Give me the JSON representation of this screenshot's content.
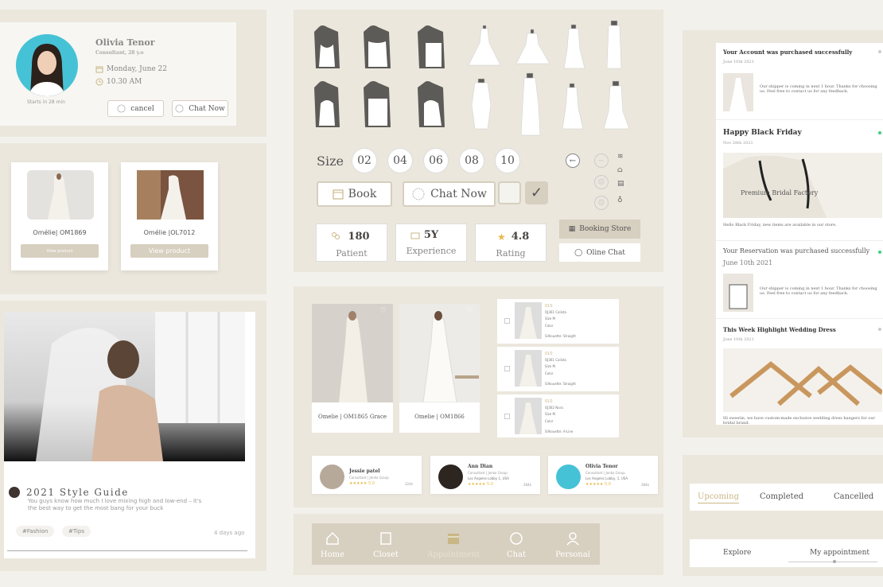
{
  "consult": {
    "name": "Olivia Tenor",
    "role": "Consultant, 28 y.o",
    "date": "Monday, June 22",
    "time": "10.30 AM",
    "starts": "Starts in 28 min",
    "cancel": "cancel",
    "chat": "Chat Now"
  },
  "products": [
    {
      "name": "Omélie| OM1869",
      "button": "View product"
    },
    {
      "name": "Omélie |OL7012",
      "button": "View product"
    }
  ],
  "blog": {
    "title": "2021 Style Guide",
    "excerpt": "You guys know how much I love mixing high and low-end – it's the best way to get the most bang for your buck",
    "tags": [
      "#Fashion",
      "#Tips"
    ],
    "time": "4 days ago"
  },
  "sizes": {
    "label": "Size",
    "options": [
      "02",
      "04",
      "06",
      "08",
      "10"
    ]
  },
  "actions": {
    "book": "Book",
    "chat_now": "Chat Now",
    "booking_store": "Booking Store",
    "online_chat": "Oline Chat"
  },
  "stats": [
    {
      "value": "180",
      "label": "Patient"
    },
    {
      "value": "5Y",
      "label": "Experience"
    },
    {
      "value": "4.8",
      "label": "Rating"
    }
  ],
  "catalog": [
    {
      "name": "Omelie | OM1865 Grace"
    },
    {
      "name": "Omelie | OM1866"
    }
  ],
  "list_items": [
    {
      "code": "010",
      "name": "OJ361 Calista",
      "size": "Size M",
      "color": "Color",
      "sil": "Silhouette: Straight"
    },
    {
      "code": "010",
      "name": "OJ361 Calista",
      "size": "Size M",
      "color": "Color",
      "sil": "Silhouette: Straight"
    },
    {
      "code": "010",
      "name": "OJ362 Nora",
      "size": "Size M",
      "color": "Color",
      "sil": "Silhouette: A-Line"
    }
  ],
  "consultants": [
    {
      "name": "Jessie patel",
      "role": "Consultant | Jenko Group",
      "loc": "",
      "rating": "★★★★★ 5.0",
      "count": "324k"
    },
    {
      "name": "Ann Dian",
      "role": "Consultant | Jenko Group",
      "loc": "Los Angeles Lobby 1, USA",
      "rating": "★★★★★ 5.0",
      "count": "284k"
    },
    {
      "name": "Olivia Tenor",
      "role": "Consultant | Jenko Group",
      "loc": "Los Angeles Lobby, 1, USA",
      "rating": "★★★★★ 5.0",
      "count": "284k"
    }
  ],
  "nav": [
    "Home",
    "Closet",
    "Appointment",
    "Chat",
    "Personal"
  ],
  "feed": [
    {
      "title": "Your Account was purchased successfully",
      "date": "June 10th 2021",
      "text": "Our shipper is coming in next 1 hour. Thanks for choosing us. Feel free to contact us for any feedback."
    },
    {
      "title": "Happy Black Friday",
      "date": "Nov 28th 2021",
      "text": "Hello Black Friday, new items are available in our store.",
      "banner": "Premium Bridal Factory"
    },
    {
      "title": "Your Reservation was purchased successfully",
      "date": "June 10th 2021",
      "text": "Our shipper is coming in next 1 hour. Thanks for choosing us. Feel free to contact us for any feedback."
    },
    {
      "title": "This Week Highlight Wedding Dress",
      "date": "June 10th 2021",
      "text": "Hi sweetie, we have custom-made exclusive wedding dress hangers for our bridal brand."
    }
  ],
  "tabs": [
    "Upcoming",
    "Completed",
    "Cancelled"
  ],
  "bottom_tabs": [
    "Explore",
    "My appointment"
  ],
  "colors": {
    "accent": "#c9c0a8",
    "panel": "#ebe7dd",
    "dot_green": "#3ecf7a"
  }
}
